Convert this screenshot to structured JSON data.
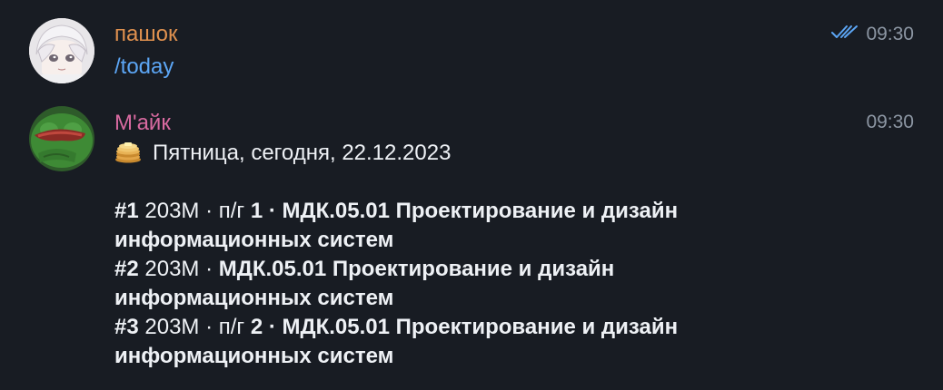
{
  "messages": [
    {
      "sender": "пашок",
      "sender_color": "#E0914F",
      "time": "09:30",
      "read_icon": "double-check-icon",
      "text": "/today"
    },
    {
      "sender": "М'айк",
      "sender_color": "#D86AA0",
      "time": "09:30",
      "header_icon": "pancakes-emoji",
      "header_text": "Пятница, сегодня, 22.12.2023",
      "lessons": [
        {
          "num": "#1",
          "room_group": " 203М · п/г ",
          "subgroup": "1",
          "title_a": " · МДК.05.01 Проектирование и дизайн",
          "title_b": "информационных систем"
        },
        {
          "num": "#2",
          "room_group": " 203М · ",
          "subgroup": "",
          "title_a": "МДК.05.01 Проектирование и дизайн",
          "title_b": "информационных систем"
        },
        {
          "num": "#3",
          "room_group": " 203М · п/г ",
          "subgroup": "2",
          "title_a": " · МДК.05.01 Проектирование и дизайн",
          "title_b": "информационных систем"
        }
      ]
    }
  ],
  "colors": {
    "background": "#181C23",
    "command_link": "#5CA6F5",
    "time": "#8C96A3",
    "check": "#5CA6F5"
  }
}
